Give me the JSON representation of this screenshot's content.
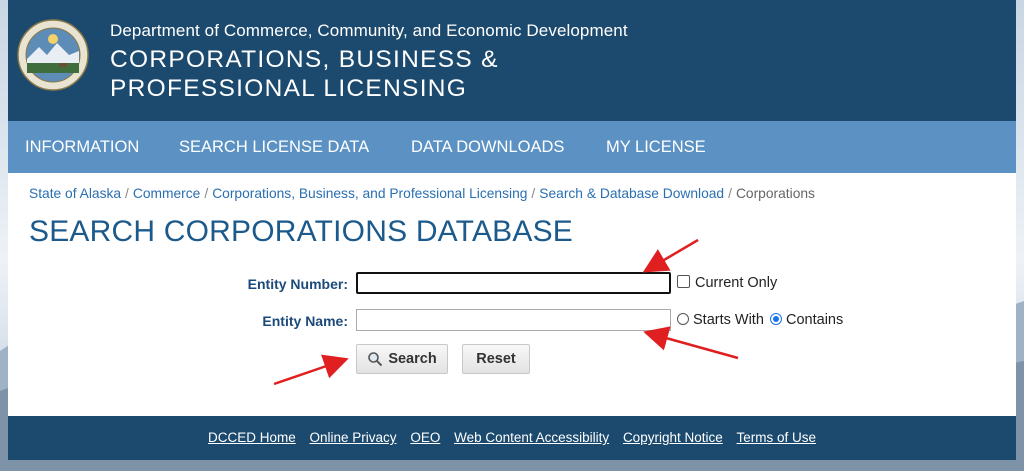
{
  "header": {
    "department": "Department of Commerce, Community, and Economic Development",
    "title_line1": "CORPORATIONS, BUSINESS &",
    "title_line2": "PROFESSIONAL LICENSING",
    "seal_icon": "state-seal-icon"
  },
  "nav": {
    "items": [
      {
        "label": "INFORMATION"
      },
      {
        "label": "SEARCH LICENSE DATA"
      },
      {
        "label": "DATA DOWNLOADS"
      },
      {
        "label": "MY LICENSE"
      }
    ]
  },
  "breadcrumb": {
    "items": [
      {
        "label": "State of Alaska"
      },
      {
        "label": "Commerce"
      },
      {
        "label": "Corporations, Business, and Professional Licensing"
      },
      {
        "label": "Search & Database Download"
      }
    ],
    "separator": "/",
    "current": "Corporations"
  },
  "page_title": "SEARCH CORPORATIONS DATABASE",
  "form": {
    "entity_number": {
      "label": "Entity Number:",
      "value": ""
    },
    "current_only": {
      "label": "Current Only",
      "checked": false
    },
    "entity_name": {
      "label": "Entity Name:",
      "value": ""
    },
    "starts_with": {
      "label": "Starts With",
      "selected": false
    },
    "contains": {
      "label": "Contains",
      "selected": true
    },
    "search_button": {
      "label": "Search",
      "icon": "magnifier-icon"
    },
    "reset_button": {
      "label": "Reset"
    }
  },
  "footer": {
    "links": [
      {
        "label": "DCCED Home"
      },
      {
        "label": "Online Privacy"
      },
      {
        "label": "OEO"
      },
      {
        "label": "Web Content Accessibility"
      },
      {
        "label": "Copyright Notice"
      },
      {
        "label": "Terms of Use"
      }
    ]
  },
  "colors": {
    "header_bg": "#1c4a6e",
    "nav_bg": "#5b92c3",
    "title_blue": "#1c5a8c",
    "link_blue": "#2a6fb1",
    "annotation_arrow": "#e02020"
  }
}
